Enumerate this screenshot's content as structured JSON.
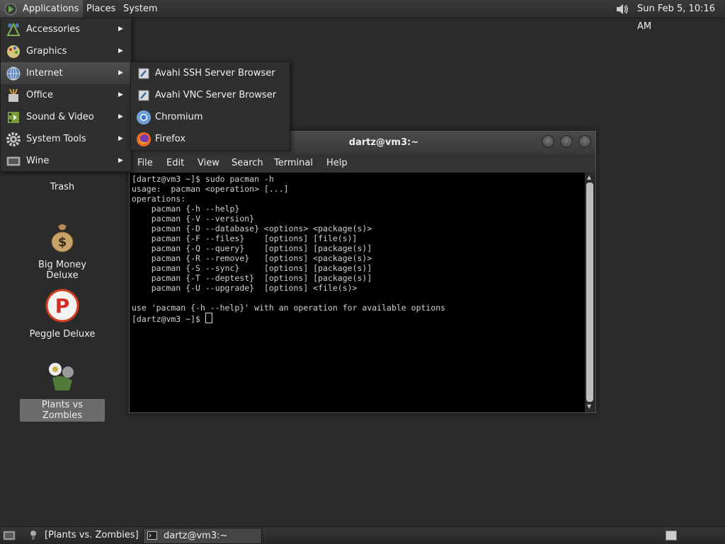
{
  "top_panel": {
    "applications": "Applications",
    "places": "Places",
    "system": "System",
    "volume_icon": "speaker-icon",
    "clock": "Sun Feb  5, 10:16 AM"
  },
  "apps_menu": {
    "items": [
      {
        "label": "Accessories",
        "icon": "accessories-icon"
      },
      {
        "label": "Graphics",
        "icon": "graphics-icon"
      },
      {
        "label": "Internet",
        "icon": "globe-icon"
      },
      {
        "label": "Office",
        "icon": "office-icon"
      },
      {
        "label": "Sound & Video",
        "icon": "media-icon"
      },
      {
        "label": "System Tools",
        "icon": "gear-icon"
      },
      {
        "label": "Wine",
        "icon": "wine-icon"
      }
    ],
    "active": "Internet",
    "submenu": [
      {
        "label": "Avahi SSH Server Browser",
        "icon": "network-icon"
      },
      {
        "label": "Avahi VNC Server Browser",
        "icon": "network-icon"
      },
      {
        "label": "Chromium",
        "icon": "chromium-icon"
      },
      {
        "label": "Firefox",
        "icon": "firefox-icon"
      }
    ]
  },
  "desktop": {
    "icons": [
      {
        "label": "Trash"
      },
      {
        "label": "Big Money Deluxe"
      },
      {
        "label": "Peggle Deluxe"
      },
      {
        "label": "Plants vs Zombies"
      }
    ]
  },
  "terminal": {
    "title": "dartz@vm3:~",
    "menu": [
      "File",
      "Edit",
      "View",
      "Search",
      "Terminal",
      "Help"
    ],
    "lines": [
      "[dartz@vm3 ~]$ sudo pacman -h",
      "usage:  pacman <operation> [...]",
      "operations:",
      "    pacman {-h --help}",
      "    pacman {-V --version}",
      "    pacman {-D --database} <options> <package(s)>",
      "    pacman {-F --files}    [options] [file(s)]",
      "    pacman {-Q --query}    [options] [package(s)]",
      "    pacman {-R --remove}   [options] <package(s)>",
      "    pacman {-S --sync}     [options] [package(s)]",
      "    pacman {-T --deptest}  [options] [package(s)]",
      "    pacman {-U --upgrade}  [options] <file(s)>",
      "",
      "use 'pacman {-h --help}' with an operation for available options",
      "[dartz@vm3 ~]$ "
    ]
  },
  "bottom_panel": {
    "tasks": [
      {
        "label": "[Plants vs. Zombies]"
      },
      {
        "label": "dartz@vm3:~"
      }
    ]
  }
}
